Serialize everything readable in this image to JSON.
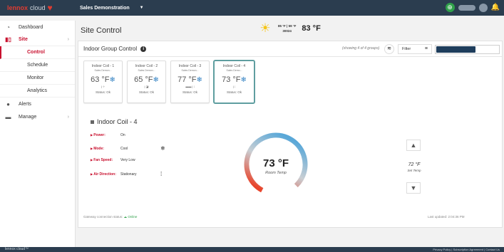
{
  "header": {
    "brand_name": "lennox",
    "brand_cloud": "cloud",
    "project_name": "Sales Demonstration"
  },
  "sidebar": {
    "items": [
      {
        "label": "Dashboard",
        "icon": "speedometer-icon"
      },
      {
        "label": "Site",
        "icon": "building-icon"
      },
      {
        "label": "Alerts",
        "icon": "alert-circle-icon"
      },
      {
        "label": "Manage",
        "icon": "briefcase-icon"
      }
    ],
    "site_sub": [
      "Control",
      "Schedule",
      "Monitor",
      "Analytics"
    ]
  },
  "page": {
    "title": "Site Control"
  },
  "weather": {
    "hilo": "85 °F | 59 °F",
    "zip": "30024",
    "current": "83 °F"
  },
  "group_panel": {
    "title": "Indoor Group Control",
    "showing": "(showing 4 of 4 groups)",
    "filter_label": "Filter"
  },
  "cards": [
    {
      "name": "Indoor Coil - 1",
      "subtitle": "Sales Demon...",
      "temp": "63 °F",
      "status": "Status: Ok"
    },
    {
      "name": "Indoor Coil - 2",
      "subtitle": "Sales Demon...",
      "temp": "65 °F",
      "status": "Status: Ok"
    },
    {
      "name": "Indoor Coil - 3",
      "subtitle": "Sales Demon...",
      "temp": "77 °F",
      "status": "Status: Ok"
    },
    {
      "name": "Indoor Coil - 4",
      "subtitle": "Sales Demo...",
      "temp": "73 °F",
      "status": "Status: Ok"
    }
  ],
  "detail": {
    "title": "Indoor Coil - 4",
    "rows": [
      {
        "label": "Power:",
        "value": "On"
      },
      {
        "label": "Mode:",
        "value": "Cool"
      },
      {
        "label": "Fan Speed:",
        "value": "Very Low"
      },
      {
        "label": "Air Direction:",
        "value": "Stationary"
      }
    ],
    "room_temp": "73 °F",
    "room_temp_label": "Room Temp",
    "set_temp": "72 °F",
    "set_temp_label": "Set Temp"
  },
  "status": {
    "gateway_label": "Gateway connection status:",
    "gateway_value": "Online",
    "last_updated": "Last updated: 2:04:36 PM"
  },
  "footer": {
    "left": "lennox cloud™",
    "right": "Privacy Policy | Subscription Agreement | Contact Us"
  },
  "colors": {
    "brand_red": "#c8102e",
    "topbar": "#2b3d4f",
    "online_green": "#2fa14a",
    "cool_blue": "#2e7fc1"
  }
}
